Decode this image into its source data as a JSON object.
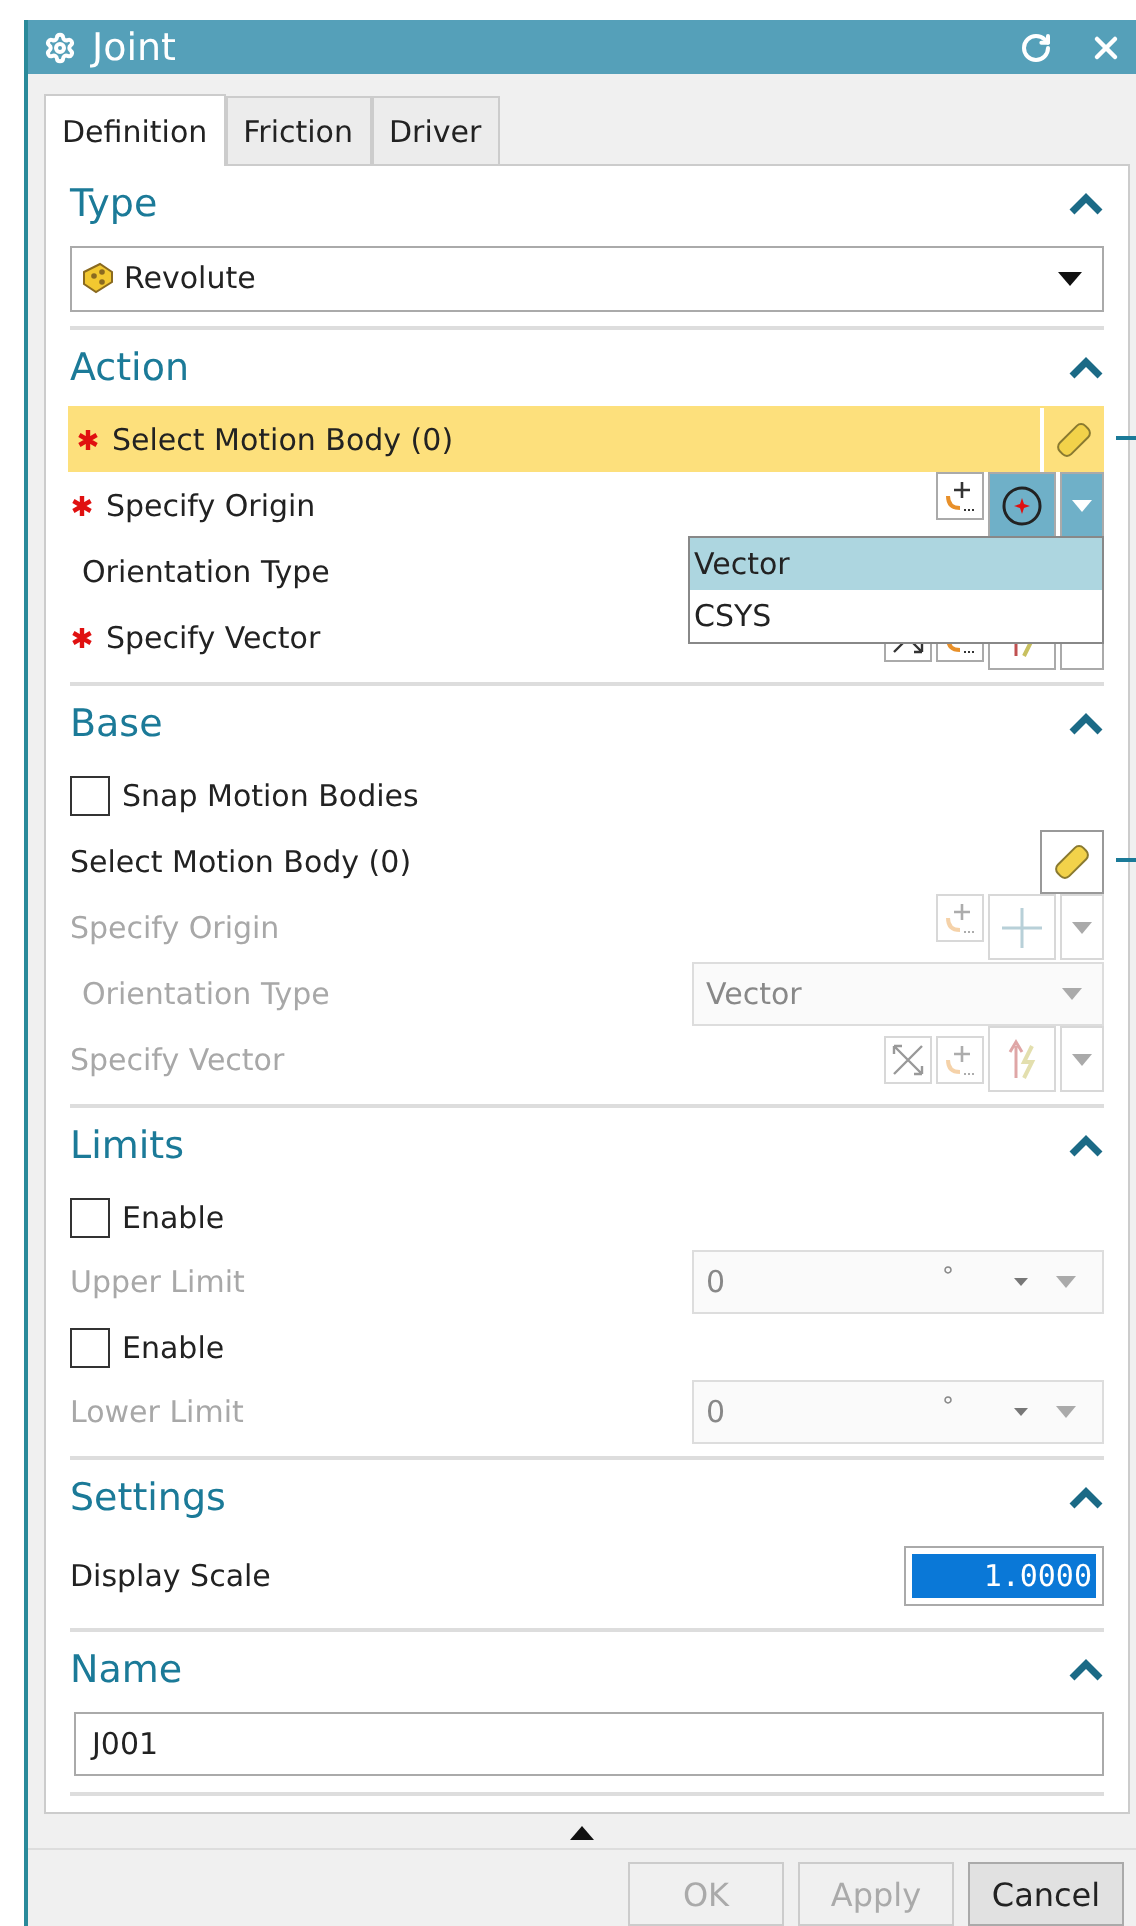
{
  "window": {
    "title": "Joint"
  },
  "tabs": [
    {
      "label": "Definition",
      "selected": true
    },
    {
      "label": "Friction",
      "selected": false
    },
    {
      "label": "Driver",
      "selected": false
    }
  ],
  "sections": [
    {
      "title": "Type",
      "expanded": true,
      "rows": [
        {
          "kind": "combo",
          "value": "Revolute"
        }
      ]
    },
    {
      "title": "Action",
      "expanded": true,
      "rows": [
        {
          "kind": "select",
          "label": "Select Motion Body (0)",
          "required": true,
          "highlighted": true,
          "disabled": false
        },
        {
          "kind": "point",
          "label": "Specify Origin",
          "required": true,
          "disabled": false,
          "active": true
        },
        {
          "kind": "orientation",
          "label": "Orientation Type",
          "disabled": false,
          "menu": [
            {
              "label": "Vector",
              "selected": true
            },
            {
              "label": "CSYS",
              "selected": false
            }
          ]
        },
        {
          "kind": "vector",
          "label": "Specify Vector",
          "required": true,
          "disabled": false
        }
      ]
    },
    {
      "title": "Base",
      "expanded": true,
      "rows": [
        {
          "kind": "checkbox",
          "label": "Snap Motion Bodies",
          "checked": false
        },
        {
          "kind": "select",
          "label": "Select Motion Body (0)",
          "required": false,
          "highlighted": false,
          "disabled": false
        },
        {
          "kind": "point",
          "label": "Specify Origin",
          "required": false,
          "disabled": true,
          "active": false
        },
        {
          "kind": "orientation",
          "label": "Orientation Type",
          "disabled": true,
          "value": "Vector"
        },
        {
          "kind": "vector",
          "label": "Specify Vector",
          "required": false,
          "disabled": true
        }
      ]
    },
    {
      "title": "Limits",
      "expanded": true,
      "rows": [
        {
          "kind": "checkbox",
          "label": "Enable",
          "checked": false
        },
        {
          "kind": "limit",
          "label": "Upper Limit",
          "value": "0",
          "unit": "°",
          "disabled": true
        },
        {
          "kind": "checkbox",
          "label": "Enable",
          "checked": false
        },
        {
          "kind": "limit",
          "label": "Lower Limit",
          "value": "0",
          "unit": "°",
          "disabled": true
        }
      ]
    },
    {
      "title": "Settings",
      "expanded": true,
      "rows": [
        {
          "kind": "number",
          "label": "Display Scale",
          "value": "1.0000",
          "selected": true
        }
      ]
    },
    {
      "title": "Name",
      "expanded": true,
      "rows": [
        {
          "kind": "text",
          "value": "J001"
        }
      ]
    }
  ],
  "buttons": [
    {
      "label": "OK",
      "disabled": true
    },
    {
      "label": "Apply",
      "disabled": true
    },
    {
      "label": "Cancel",
      "disabled": false
    }
  ]
}
